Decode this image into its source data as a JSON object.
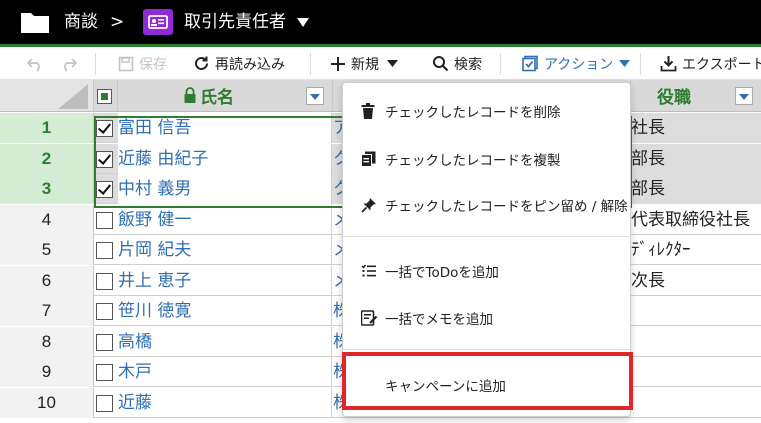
{
  "titlebar": {
    "app": "商談",
    "separator": ">",
    "view": "取引先責任者"
  },
  "toolbar": {
    "save": "保存",
    "reload": "再読み込み",
    "new": "新規",
    "search": "検索",
    "action": "アクション",
    "export": "エクスポート"
  },
  "grid": {
    "headers": {
      "name": "氏名",
      "role": "役職"
    },
    "rows": [
      {
        "num": "1",
        "name": "富田 信吾",
        "col2": "ア",
        "role": "社長",
        "checked": true
      },
      {
        "num": "2",
        "name": "近藤 由紀子",
        "col2": "ク",
        "role": "部長",
        "checked": true
      },
      {
        "num": "3",
        "name": "中村 義男",
        "col2": "ク",
        "role": "部長",
        "checked": true
      },
      {
        "num": "4",
        "name": "飯野 健一",
        "col2": "メ",
        "role": "代表取締役社長",
        "checked": false
      },
      {
        "num": "5",
        "name": "片岡 紀夫",
        "col2": "メ",
        "role": "ﾃﾞｨﾚｸﾀｰ",
        "checked": false
      },
      {
        "num": "6",
        "name": "井上 恵子",
        "col2": "メ",
        "role": "次長",
        "checked": false
      },
      {
        "num": "7",
        "name": "笹川 徳寛",
        "col2": "株",
        "role": "",
        "checked": false
      },
      {
        "num": "8",
        "name": "高橋",
        "col2": "株",
        "role": "",
        "checked": false
      },
      {
        "num": "9",
        "name": "木戸",
        "col2": "株",
        "role": "",
        "checked": false
      },
      {
        "num": "10",
        "name": "近藤",
        "col2": "株",
        "role": "",
        "checked": false
      }
    ]
  },
  "menu": {
    "items": [
      "チェックしたレコードを削除",
      "チェックしたレコードを複製",
      "チェックしたレコードをピン留め / 解除",
      "一括でToDoを追加",
      "一括でメモを追加",
      "キャンペーンに追加"
    ]
  },
  "colors": {
    "accent_green": "#2e7d32",
    "link_blue": "#2f6fb4",
    "highlight_red": "#e0262d",
    "card_purple": "#8e2bd6"
  }
}
